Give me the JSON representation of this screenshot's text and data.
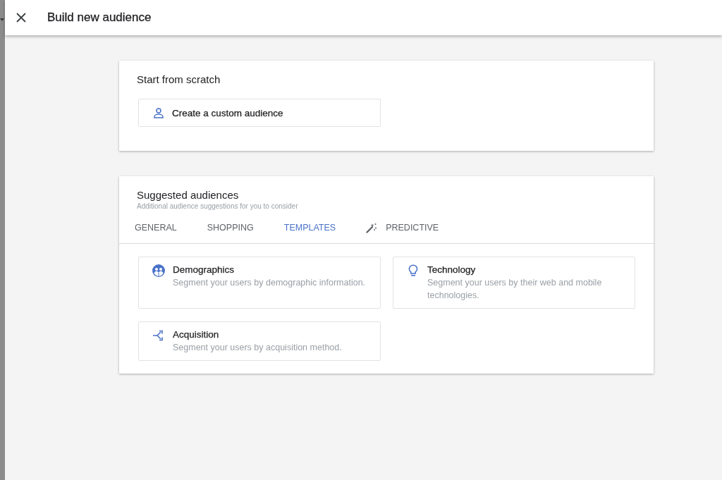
{
  "header": {
    "title": "Build new audience"
  },
  "start_from_scratch": {
    "title": "Start from scratch",
    "option": {
      "label": "Create a custom audience"
    }
  },
  "suggested_audiences": {
    "title": "Suggested audiences",
    "subtitle": "Additional audience suggestions for you to consider",
    "tabs": [
      {
        "label": "GENERAL",
        "selected": false,
        "kind": "text"
      },
      {
        "label": "SHOPPING",
        "selected": false,
        "kind": "text"
      },
      {
        "label": "TEMPLATES",
        "selected": true,
        "kind": "text"
      },
      {
        "label": "PREDICTIVE",
        "selected": false,
        "kind": "wand"
      }
    ],
    "templates": [
      {
        "kind": "demographics",
        "title": "Demographics",
        "description": "Segment your users by demographic information."
      },
      {
        "kind": "technology",
        "title": "Technology",
        "description": "Segment your users by their web and mobile technologies."
      },
      {
        "kind": "acquisition",
        "title": "Acquisition",
        "description": "Segment your users by acquisition method."
      }
    ]
  }
}
